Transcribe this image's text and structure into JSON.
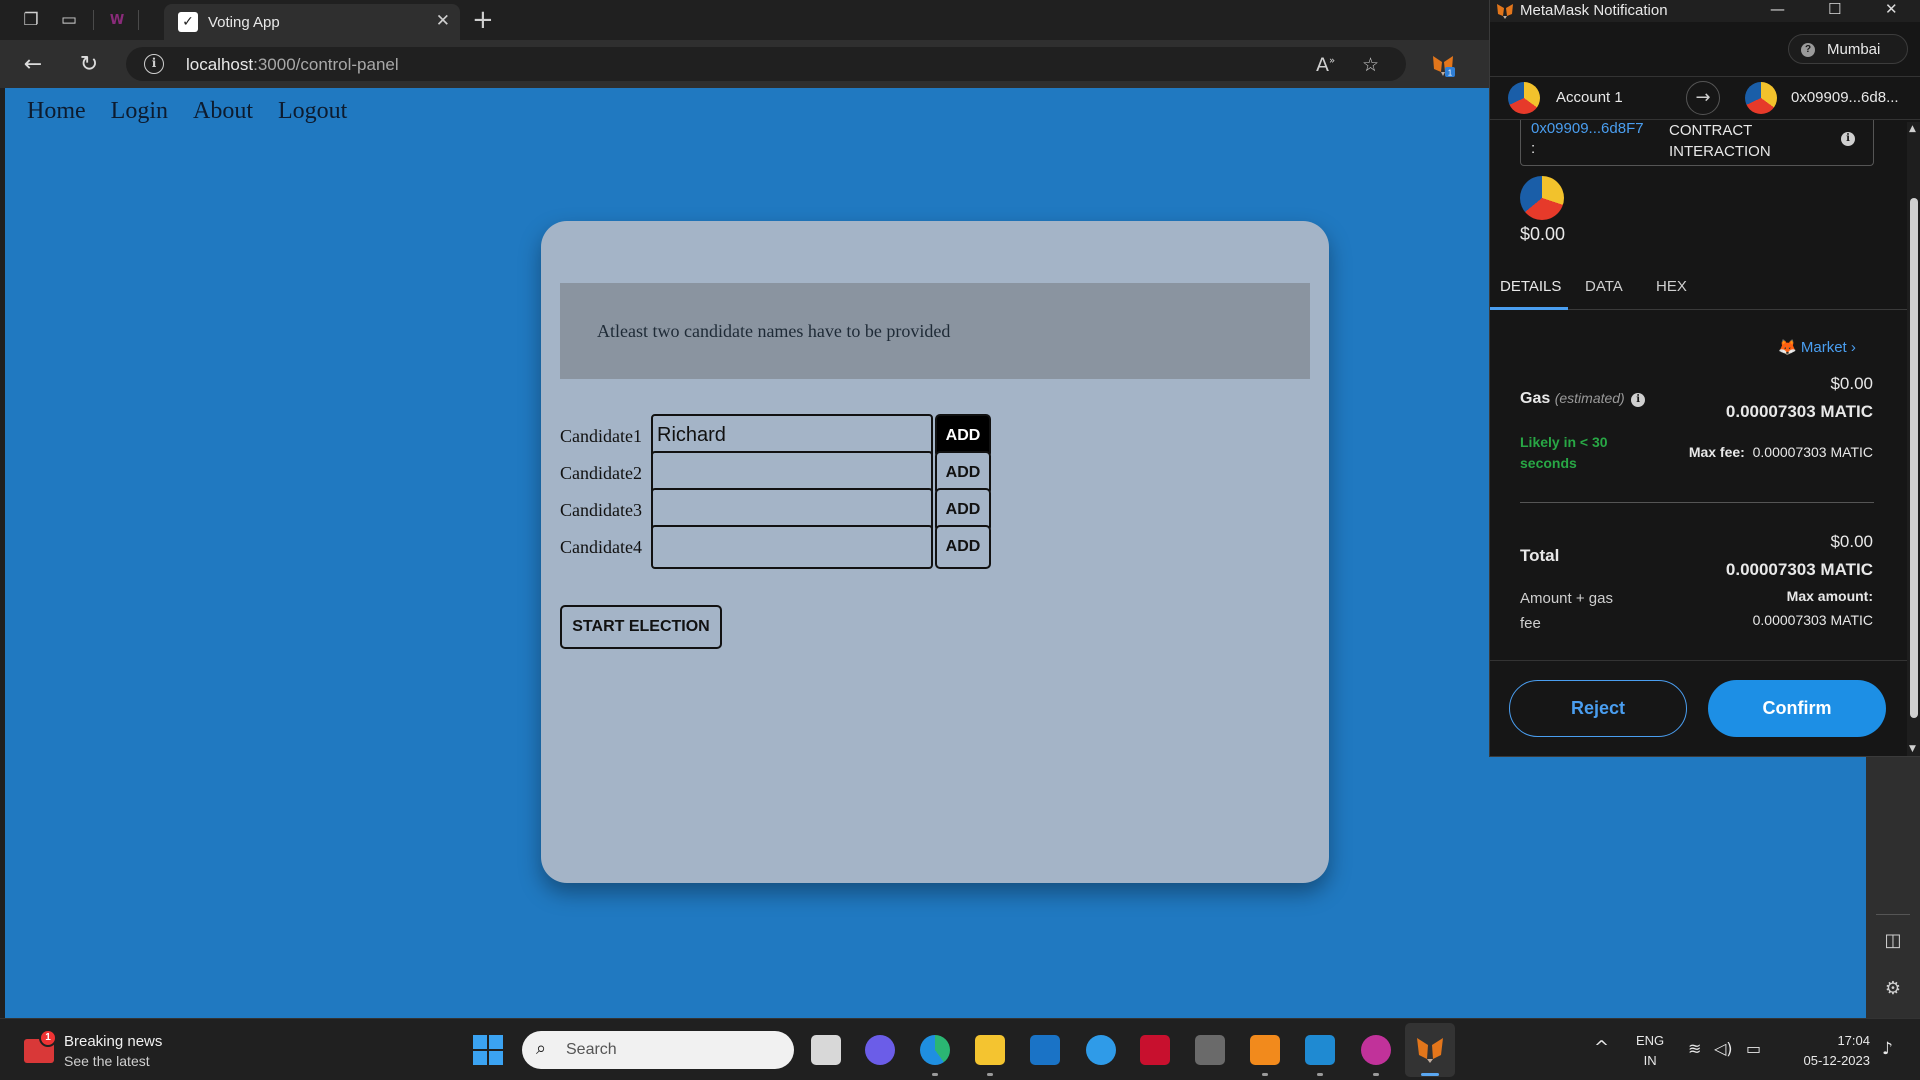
{
  "browser": {
    "tab_title": "Voting App",
    "tab_close": "✕",
    "new_tab": "+",
    "url_host": "localhost",
    "url_path": ":3000/control-panel"
  },
  "site": {
    "nav": [
      "Home",
      "Login",
      "About",
      "Logout"
    ],
    "alert": "Atleast two candidate names have to be provided",
    "candidates": [
      {
        "label": "Candidate1",
        "value": "Richard",
        "button": "ADD"
      },
      {
        "label": "Candidate2",
        "value": "",
        "button": "ADD"
      },
      {
        "label": "Candidate3",
        "value": "",
        "button": "ADD"
      },
      {
        "label": "Candidate4",
        "value": "",
        "button": "ADD"
      }
    ],
    "start_button": "START ELECTION"
  },
  "metamask": {
    "window_title": "MetaMask Notification",
    "network": "Mumbai",
    "from_account": "Account 1",
    "to_account": "0x09909...6d8...",
    "contract_address": "0x09909...6d8F7",
    "contract_colon": ":",
    "contract_type": "CONTRACT INTERACTION",
    "amount_usd": "$0.00",
    "tabs": [
      "DETAILS",
      "DATA",
      "HEX"
    ],
    "market_label": "Market",
    "gas_label": "Gas",
    "gas_estimated": "(estimated)",
    "gas_usd": "$0.00",
    "gas_matic": "0.00007303 MATIC",
    "likely": "Likely in < 30 seconds",
    "max_fee_label": "Max fee:",
    "max_fee_value": "0.00007303 MATIC",
    "total_label": "Total",
    "total_usd": "$0.00",
    "total_matic": "0.00007303 MATIC",
    "amount_gas_label": "Amount + gas fee",
    "max_amount_label": "Max amount:",
    "max_amount_value": "0.00007303 MATIC",
    "reject": "Reject",
    "confirm": "Confirm"
  },
  "taskbar": {
    "news_title": "Breaking news",
    "news_sub": "See the latest",
    "news_badge": "1",
    "search_placeholder": "Search",
    "lang_line1": "ENG",
    "lang_line2": "IN",
    "time": "17:04",
    "date": "05-12-2023"
  },
  "colors": {
    "page_bg": "#2079c1",
    "card_bg": "#a4b4c7",
    "alert_bg": "#8a94a0",
    "mm_accent": "#4a9ef0",
    "mm_confirm": "#1d8fe5",
    "mm_green": "#28a745"
  }
}
